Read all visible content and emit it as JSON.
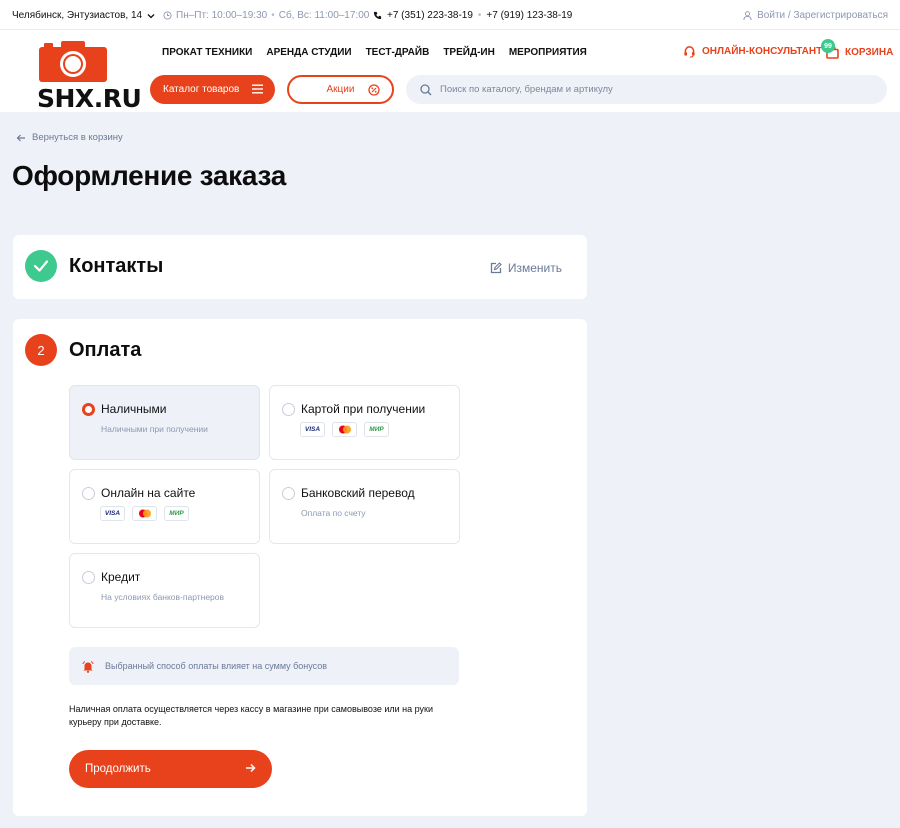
{
  "topbar": {
    "city": "Челябинск, Энтузиастов, 14",
    "hours_weekdays": "Пн–Пт: 10:00–19:30",
    "hours_weekend": "Сб, Вс: 11:00–17:00",
    "phone1": "+7 (351) 223-38-19",
    "phone2": "+7 (919) 123-38-19",
    "login": "Войти / Зарегистрироваться"
  },
  "header": {
    "logo_text": "SHX.RU",
    "nav": [
      "ПРОКАТ ТЕХНИКИ",
      "АРЕНДА СТУДИИ",
      "ТЕСТ-ДРАЙВ",
      "ТРЕЙД-ИН",
      "МЕРОПРИЯТИЯ"
    ],
    "consultant": "ОНЛАЙН-КОНСУЛЬТАНТ",
    "cart_label": "КОРЗИНА",
    "cart_count": "99",
    "catalog_button": "Каталог товаров",
    "promo_button": "Акции",
    "search_placeholder": "Поиск по каталогу, брендам и артикулу"
  },
  "back_link": "Вернуться в корзину",
  "page_title": "Оформление заказа",
  "contacts": {
    "title": "Контакты",
    "edit_label": "Изменить"
  },
  "payment": {
    "step": "2",
    "title": "Оплата",
    "options": [
      {
        "label": "Наличными",
        "sub": "Наличными при получении",
        "selected": true
      },
      {
        "label": "Картой при получении",
        "logos": [
          "VISA",
          "MC",
          "МИР"
        ],
        "selected": false
      },
      {
        "label": "Онлайн на сайте",
        "logos": [
          "VISA",
          "MC",
          "МИР"
        ],
        "selected": false
      },
      {
        "label": "Банковский перевод",
        "sub": "Оплата по счету",
        "selected": false
      },
      {
        "label": "Кредит",
        "sub": "На условиях банков-партнеров",
        "selected": false
      }
    ],
    "notice": "Выбранный способ оплаты влияет на сумму бонусов",
    "description": "Наличная оплата осуществляется через кассу в магазине при самовывозе или на руки курьеру при доставке.",
    "continue_button": "Продолжить"
  },
  "colors": {
    "accent": "#e8421c",
    "success": "#3ec98e",
    "background": "#eef1f8",
    "muted": "#8c98b0"
  }
}
